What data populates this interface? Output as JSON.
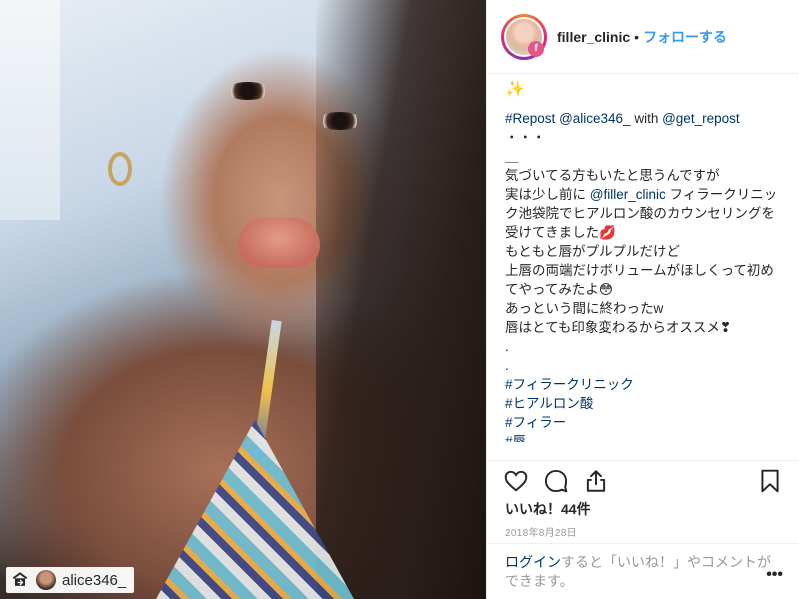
{
  "post": {
    "username": "filler_clinic",
    "separator": "•",
    "follow_label": "フォローする",
    "avatar_badge": "f",
    "sparkle": "✨",
    "caption": {
      "repost_prefix": "#Repost",
      "repost_user": "@alice346_",
      "repost_with": " with ",
      "repost_app": "@get_repost",
      "dots": "・・・",
      "underscore": "＿",
      "line1": "気づいてる方もいたと思うんですが",
      "line2_pre": "実は少し前に ",
      "line2_link": "@filler_clinic",
      "line2_post": " フィラークリニック池袋院でヒアルロン酸のカウンセリングを受けてきました",
      "lip_emoji": "💋",
      "line3": "もともと唇がプルプルだけど",
      "line4": "上唇の両端だけボリュームがほしくって初めてやってみたよ😳",
      "line5": "あっという間に終わったw",
      "line6": "唇はとても印象変わるからオススメ❣",
      "dot_a": ".",
      "dot_b": ".",
      "hashtags": [
        "#フィラークリニック",
        "#ヒアルロン酸",
        "#フィラー",
        "#唇"
      ]
    },
    "likes_label": "いいね！44件",
    "date": "2018年8月28日",
    "login_link": "ログイン",
    "login_text": "すると「いいね！」やコメントができます。",
    "more_label": "•••",
    "photo_tag_user": "alice346_"
  },
  "icons": {
    "like": "heart-icon",
    "comment": "comment-icon",
    "share": "share-icon",
    "save": "bookmark-icon",
    "repost": "repost-icon"
  },
  "colors": {
    "link": "#003569",
    "follow": "#3897f0",
    "text": "#262626",
    "muted": "#999999"
  }
}
